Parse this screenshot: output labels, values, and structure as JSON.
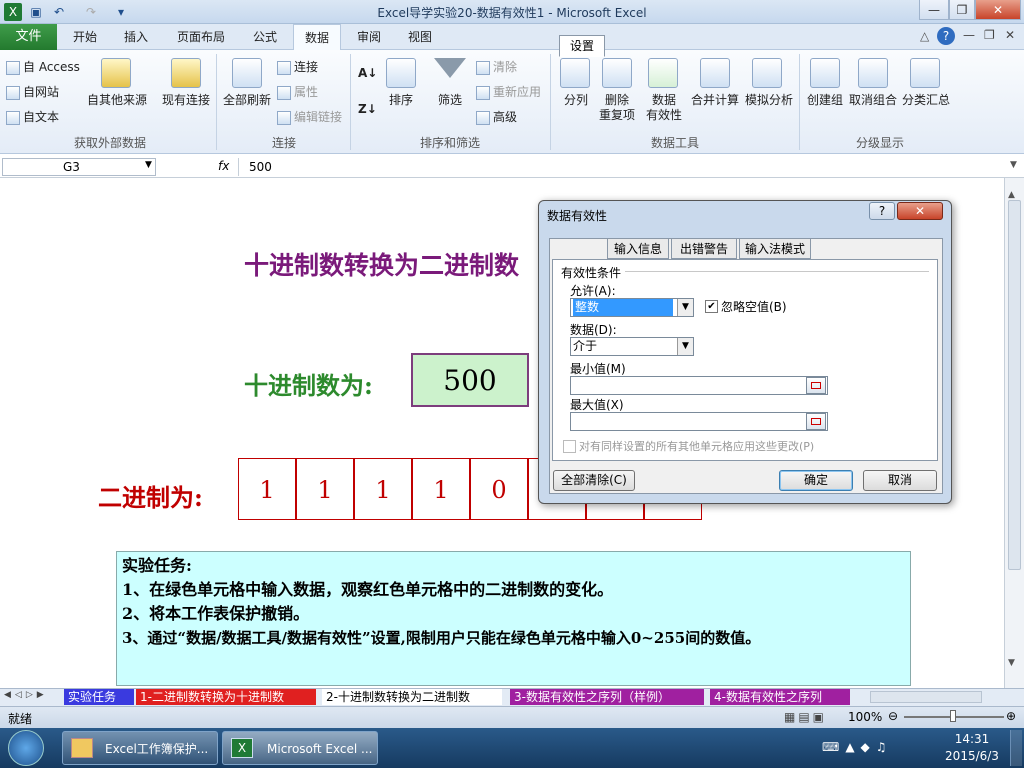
{
  "window": {
    "title": "Excel导学实验20-数据有效性1  -  Microsoft Excel"
  },
  "ribbon": {
    "file_tab": "文件",
    "tabs": [
      "开始",
      "插入",
      "页面布局",
      "公式",
      "数据",
      "审阅",
      "视图"
    ],
    "selected_tab": "数据",
    "groups": {
      "external": {
        "label": "获取外部数据",
        "access": "自 Access",
        "web": "自网站",
        "text": "自文本",
        "other": "自其他来源",
        "existing": "现有连接"
      },
      "connections": {
        "label": "连接",
        "refresh_all": "全部刷新",
        "connections": "连接",
        "properties": "属性",
        "edit_links": "编辑链接"
      },
      "sort_filter": {
        "label": "排序和筛选",
        "sort": "排序",
        "filter": "筛选",
        "clear": "清除",
        "reapply": "重新应用",
        "advanced": "高级"
      },
      "data_tools": {
        "label": "数据工具",
        "text_to_columns": "分列",
        "remove_dup_1": "删除",
        "remove_dup_2": "重复项",
        "validation_1": "数据",
        "validation_2": "有效性",
        "consolidate": "合并计算",
        "what_if": "模拟分析"
      },
      "outline": {
        "label": "分级显示",
        "group": "创建组",
        "ungroup": "取消组合",
        "subtotal": "分类汇总"
      }
    }
  },
  "formula_bar": {
    "name_box": "G3",
    "fx": "fx",
    "value": "500"
  },
  "sheet": {
    "title": "十进制数转换为二进制数",
    "decimal_label": "十进制数为:",
    "decimal_value": "500",
    "binary_label": "二进制为:",
    "binary_digits": [
      "1",
      "1",
      "1",
      "1",
      "0",
      "",
      "",
      ""
    ],
    "task": {
      "heading": "实验任务:",
      "lines": [
        "1、在绿色单元格中输入数据，观察红色单元格中的二进制数的变化。",
        "2、将本工作表保护撤销。",
        "3、通过“数据/数据工具/数据有效性”设置,限制用户只能在绿色单元格中输入0~255间的数值。"
      ]
    }
  },
  "sheet_tabs": [
    "实验任务",
    "1-二进制数转换为十进制数",
    "2-十进制数转换为二进制数",
    "3-数据有效性之序列（样例）",
    "4-数据有效性之序列"
  ],
  "status": {
    "ready": "就绪",
    "zoom": "100%"
  },
  "taskbar": {
    "item1": "Excel工作簿保护...",
    "item2": "Microsoft Excel ...",
    "time": "14:31",
    "date": "2015/6/3"
  },
  "dialog": {
    "title": "数据有效性",
    "help": "?",
    "tabs": [
      "设置",
      "输入信息",
      "出错警告",
      "输入法模式"
    ],
    "criteria_label": "有效性条件",
    "allow_label": "允许(A):",
    "allow_value": "整数",
    "ignore_blank": "忽略空值(B)",
    "data_label": "数据(D):",
    "data_value": "介于",
    "min_label": "最小值(M)",
    "max_label": "最大值(X)",
    "apply_all": "对有同样设置的所有其他单元格应用这些更改(P)",
    "clear_all": "全部清除(C)",
    "ok": "确定",
    "cancel": "取消"
  }
}
